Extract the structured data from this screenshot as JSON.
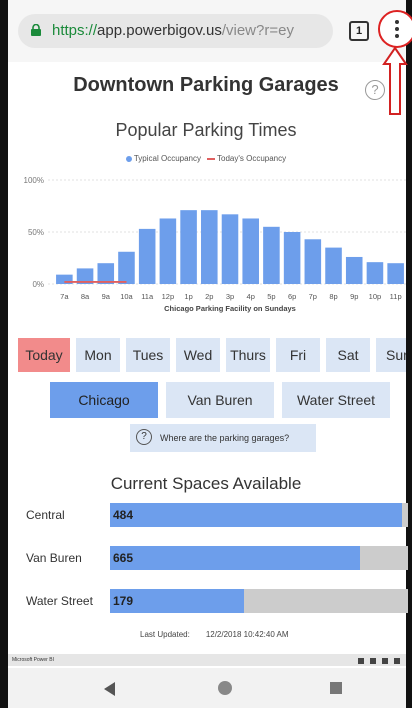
{
  "browser": {
    "url_scheme": "https://",
    "url_host": "app.powerbigov.us",
    "url_path": "/view?r=ey",
    "tab_count": "1"
  },
  "page": {
    "title": "Downtown Parking Garages",
    "help_glyph": "?"
  },
  "chart_data": {
    "type": "bar",
    "title": "Popular Parking Times",
    "xlabel": "Chicago Parking Facility on Sundays",
    "ylabel": "",
    "ylim": [
      0,
      100
    ],
    "yticks": [
      "0%",
      "50%",
      "100%"
    ],
    "legend": [
      "Typical Occupancy",
      "Today's Occupancy"
    ],
    "categories": [
      "7a",
      "8a",
      "9a",
      "10a",
      "11a",
      "12p",
      "1p",
      "2p",
      "3p",
      "4p",
      "5p",
      "6p",
      "7p",
      "8p",
      "9p",
      "10p",
      "11p"
    ],
    "series": [
      {
        "name": "Typical Occupancy",
        "values": [
          9,
          15,
          20,
          31,
          53,
          63,
          71,
          71,
          67,
          63,
          55,
          50,
          43,
          35,
          26,
          21,
          20
        ]
      },
      {
        "name": "Today's Occupancy",
        "values": [
          2,
          2,
          2,
          2
        ]
      }
    ],
    "colors": {
      "typical": "#6d9eeb",
      "today": "#e06060"
    }
  },
  "days": [
    "Today",
    "Mon",
    "Tues",
    "Wed",
    "Thurs",
    "Fri",
    "Sat",
    "Sun"
  ],
  "active_day": "Today",
  "locations": [
    "Chicago",
    "Van Buren",
    "Water Street"
  ],
  "active_location": "Chicago",
  "where_button": "Where are the parking garages?",
  "spaces": {
    "title": "Current Spaces Available",
    "rows": [
      {
        "label": "Central",
        "value": "484",
        "fill": 0.98
      },
      {
        "label": "Van Buren",
        "value": "665",
        "fill": 0.84
      },
      {
        "label": "Water Street",
        "value": "179",
        "fill": 0.45
      }
    ]
  },
  "last_updated": {
    "label": "Last Updated:",
    "value": "12/2/2018 10:42:40 AM"
  },
  "footer": {
    "brand": "Microsoft Power BI"
  },
  "colors": {
    "accent": "#6d9eeb",
    "button_bg": "#dbe6f5",
    "active_day": "#f28b8b",
    "annotation_red": "#d22222"
  }
}
